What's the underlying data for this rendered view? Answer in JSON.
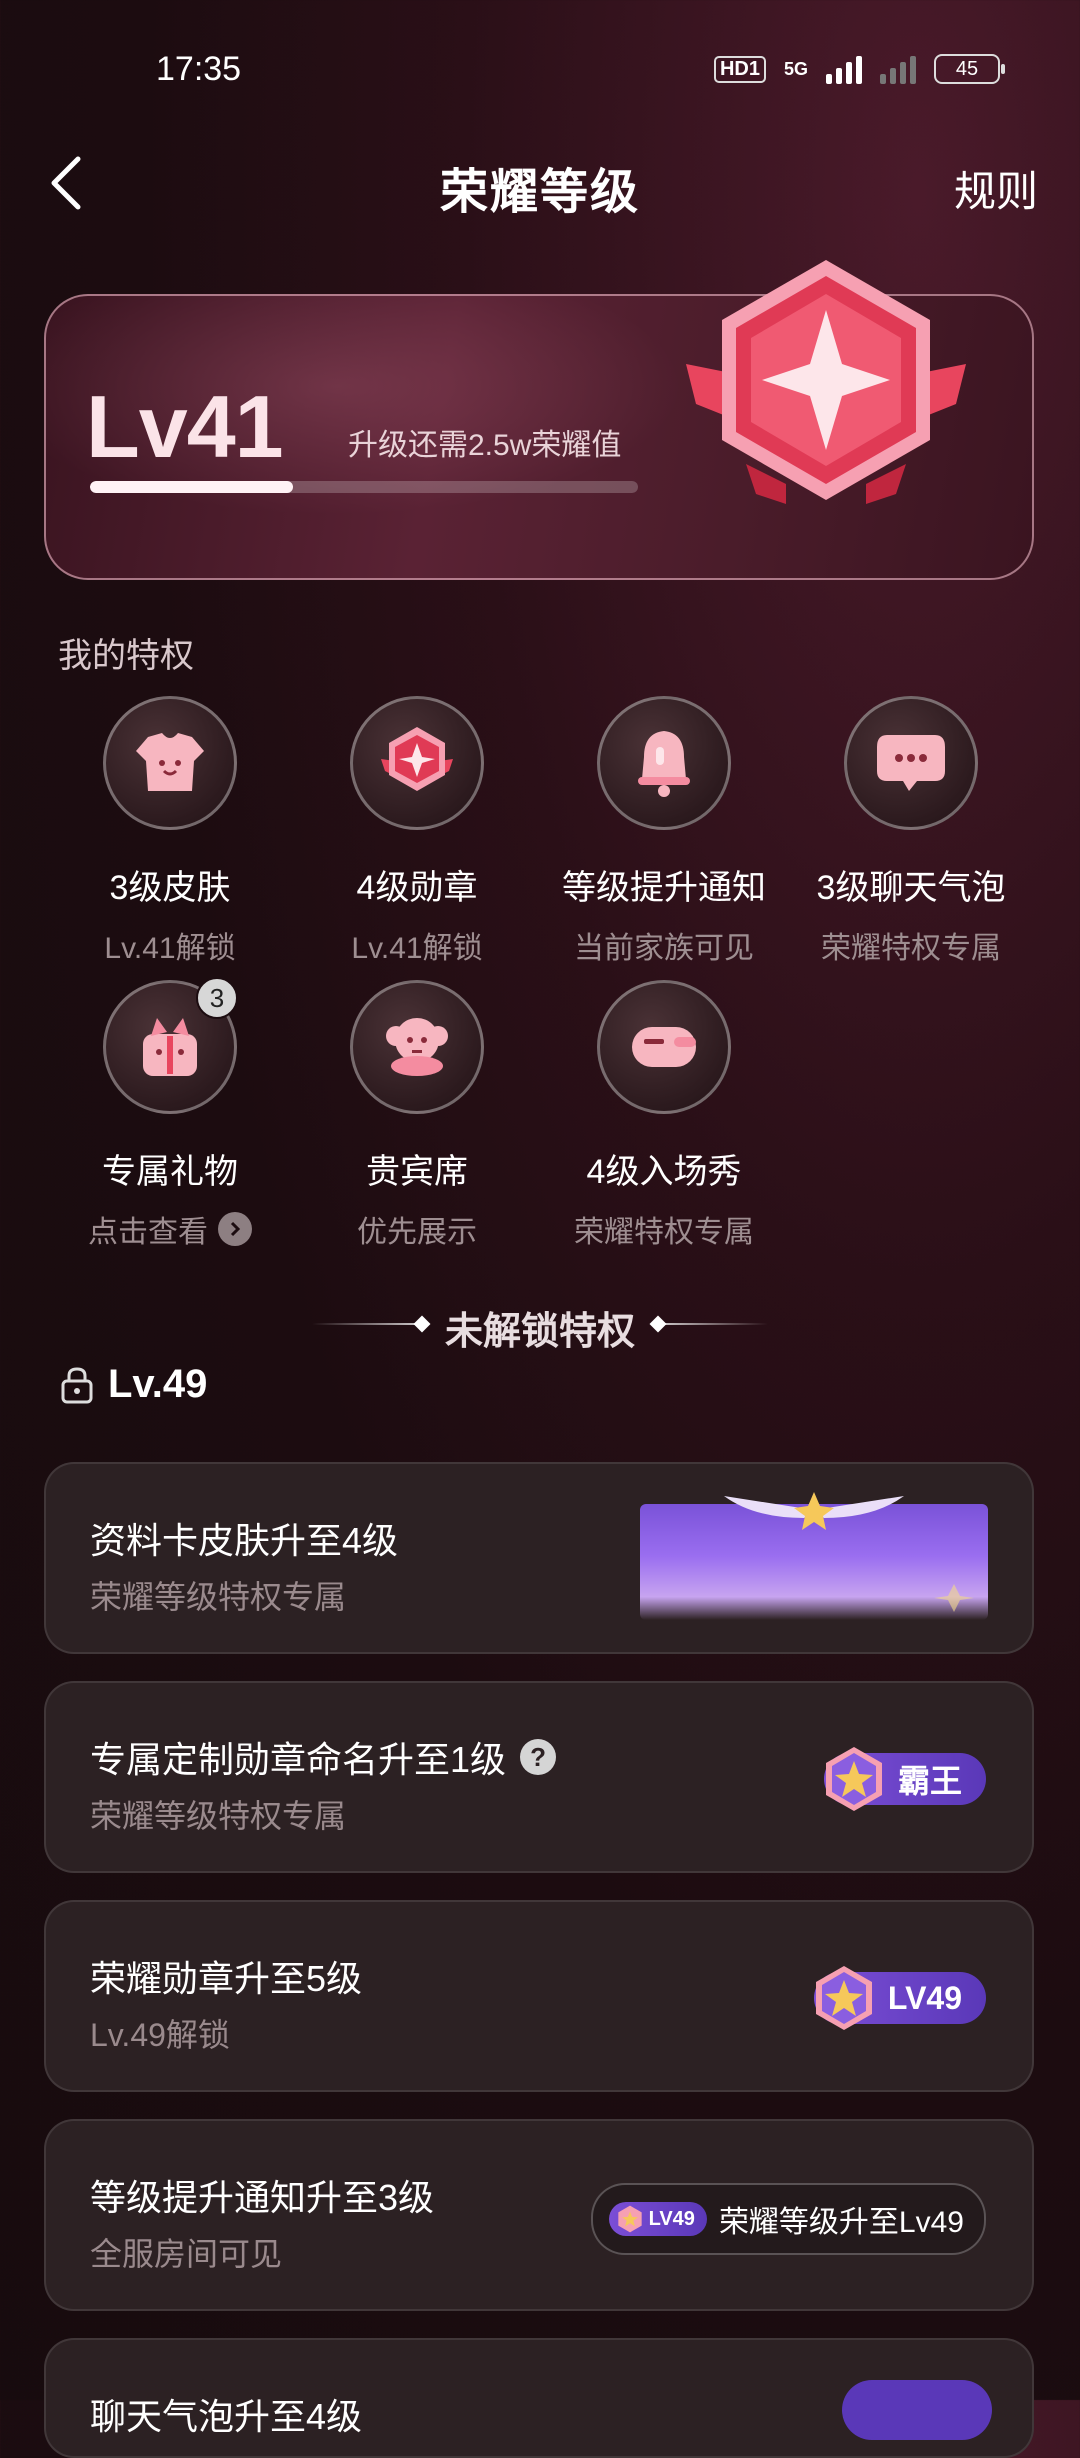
{
  "status": {
    "time": "17:35",
    "hd": "HD1",
    "network": "5G",
    "battery": "45"
  },
  "header": {
    "title": "荣耀等级",
    "rules": "规则"
  },
  "level": {
    "label": "Lv41",
    "need": "升级还需2.5w荣耀值",
    "progress": 0.37
  },
  "my_privileges": {
    "title": "我的特权",
    "items": [
      {
        "name": "3级皮肤",
        "sub": "Lv.41解锁",
        "icon": "shirt-icon"
      },
      {
        "name": "4级勋章",
        "sub": "Lv.41解锁",
        "icon": "medal-icon"
      },
      {
        "name": "等级提升通知",
        "sub": "当前家族可见",
        "icon": "bell-icon"
      },
      {
        "name": "3级聊天气泡",
        "sub": "荣耀特权专属",
        "icon": "chat-bubble-icon"
      },
      {
        "name": "专属礼物",
        "sub": "点击查看",
        "icon": "gift-icon",
        "badge": "3"
      },
      {
        "name": "贵宾席",
        "sub": "优先展示",
        "icon": "vip-seat-icon"
      },
      {
        "name": "4级入场秀",
        "sub": "荣耀特权专属",
        "icon": "entrance-icon"
      }
    ]
  },
  "locked": {
    "title": "未解锁特权",
    "level": "Lv.49",
    "cards": [
      {
        "title": "资料卡皮肤升至4级",
        "sub": "荣耀等级特权专属"
      },
      {
        "title": "专属定制勋章命名升至1级",
        "sub": "荣耀等级特权专属",
        "tag": "霸王",
        "help": "?"
      },
      {
        "title": "荣耀勋章升至5级",
        "sub": "Lv.49解锁",
        "tag": "LV49"
      },
      {
        "title": "等级提升通知升至3级",
        "sub": "全服房间可见",
        "tag": "LV49",
        "notice": "荣耀等级升至Lv49"
      },
      {
        "title": "聊天气泡升至4级"
      }
    ]
  }
}
